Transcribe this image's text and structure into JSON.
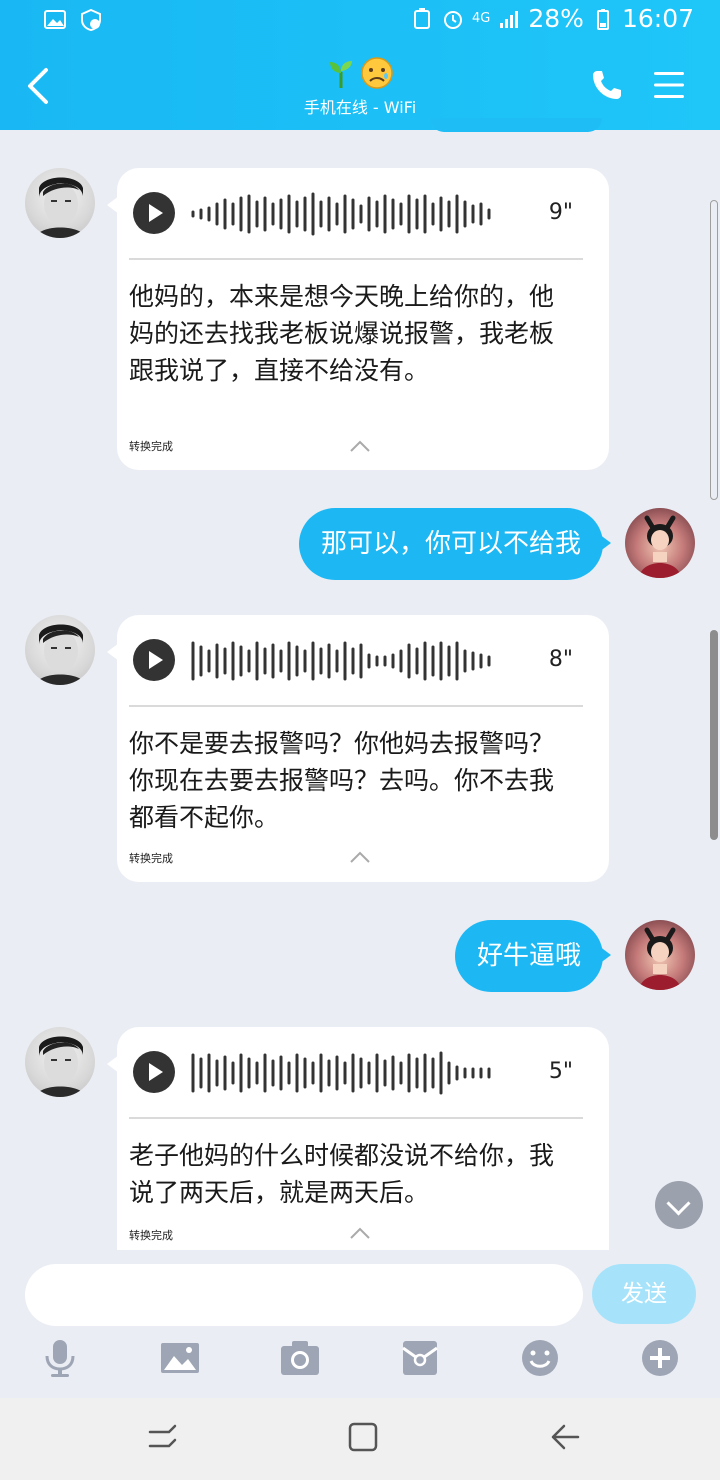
{
  "status_bar": {
    "network": "4G",
    "battery": "28%",
    "time": "16:07"
  },
  "header": {
    "subtitle": "手机在线 - WiFi",
    "icons": [
      "back-arrow-icon",
      "sprout-icon",
      "worried-face-emoji",
      "phone-icon",
      "menu-icon"
    ]
  },
  "messages": [
    {
      "side": "left",
      "type": "voice",
      "duration": "9\"",
      "transcript": "他妈的，本来是想今天晚上给你的，他妈的还去找我老板说爆说报警，我老板跟我说了，直接不给没有。",
      "status": "转换完成"
    },
    {
      "side": "right",
      "type": "text",
      "text": "那可以，你可以不给我"
    },
    {
      "side": "left",
      "type": "voice",
      "duration": "8\"",
      "transcript": "你不是要去报警吗？你他妈去报警吗？你现在去要去报警吗？去吗。你不去我都看不起你。",
      "status": "转换完成"
    },
    {
      "side": "right",
      "type": "text",
      "text": "好牛逼哦"
    },
    {
      "side": "left",
      "type": "voice",
      "duration": "5\"",
      "transcript": "老子他妈的什么时候都没说不给你，我说了两天后，就是两天后。",
      "status": "转换完成"
    }
  ],
  "input": {
    "placeholder": "",
    "send_label": "发送"
  },
  "toolbar_icons": [
    "microphone-icon",
    "image-icon",
    "camera-icon",
    "red-packet-icon",
    "emoji-icon",
    "plus-icon"
  ],
  "nav_icons": [
    "recent-apps-icon",
    "home-icon",
    "back-icon"
  ],
  "colors": {
    "header": "#1fc6f8",
    "outgoing_bubble": "#1db8f4",
    "background": "#eaedf4",
    "send_button": "#a6e3fb"
  }
}
